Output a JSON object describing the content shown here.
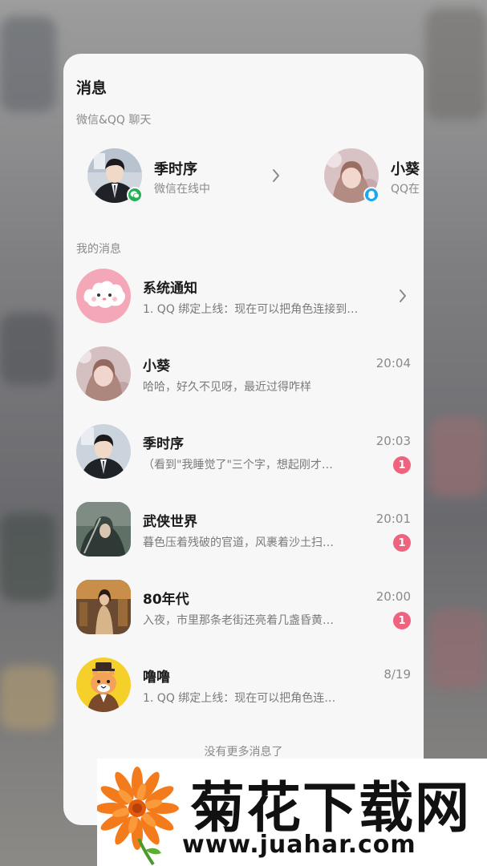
{
  "colors": {
    "accent_unread": "#f0637f",
    "wechat_badge": "#1fb153",
    "qq_badge": "#1aa8f0",
    "card_bg": "#f7f7f8"
  },
  "header": {
    "title": "消息"
  },
  "chat_section": {
    "label": "微信&QQ 聊天",
    "contacts": [
      {
        "name": "季时序",
        "status": "微信在线中",
        "platform_icon": "wechat-icon"
      },
      {
        "name": "小葵",
        "status": "QQ在",
        "platform_icon": "qq-icon"
      }
    ]
  },
  "messages_section": {
    "label": "我的消息",
    "items": [
      {
        "name": "系统通知",
        "preview": "1. QQ 绑定上线：现在可以把角色连接到…",
        "time": "",
        "unread": "",
        "avatar_icon": "cloud-mascot-icon"
      },
      {
        "name": "小葵",
        "preview": "哈哈，好久不见呀，最近过得咋样",
        "time": "20:04",
        "unread": "",
        "avatar_icon": "girl-portrait-icon"
      },
      {
        "name": "季时序",
        "preview": "（看到\"我睡觉了\"三个字，想起刚才…",
        "time": "20:03",
        "unread": "1",
        "avatar_icon": "man-portrait-icon"
      },
      {
        "name": "武侠世界",
        "preview": "暮色压着残破的官道，风裹着沙土扫…",
        "time": "20:01",
        "unread": "1",
        "avatar_icon": "swordsman-icon"
      },
      {
        "name": "80年代",
        "preview": "入夜，市里那条老街还亮着几盏昏黄…",
        "time": "20:00",
        "unread": "1",
        "avatar_icon": "retro-woman-icon"
      },
      {
        "name": "噜噜",
        "preview": "1. QQ 绑定上线：现在可以把角色连…",
        "time": "8/19",
        "unread": "",
        "avatar_icon": "cat-mascot-icon"
      }
    ],
    "end_text": "没有更多消息了"
  },
  "watermark": {
    "title": "菊花下载网",
    "url": "www.juahar.com",
    "logo_icon": "flower-logo-icon"
  }
}
